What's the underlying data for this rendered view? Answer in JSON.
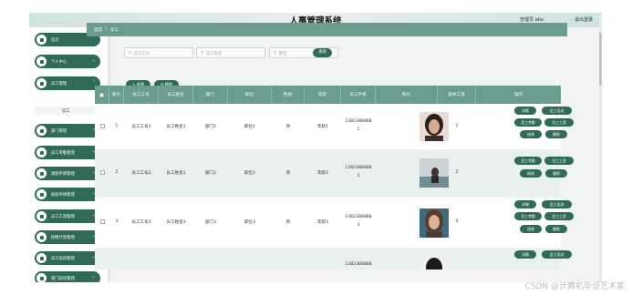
{
  "header": {
    "title": "人事管理系统",
    "user_label": "管理员 abo",
    "logout_label": "退出登录"
  },
  "sidebar": {
    "items": [
      {
        "label": "首页",
        "icon": "home-icon",
        "has_chevron": false
      },
      {
        "label": "个人中心",
        "icon": "user-icon",
        "has_chevron": true
      },
      {
        "label": "员工管理",
        "icon": "user-icon",
        "has_chevron": true
      },
      {
        "label": "部门管理",
        "icon": "shield-icon",
        "has_chevron": true
      },
      {
        "label": "员工考勤管理",
        "icon": "grid-icon",
        "has_chevron": true
      },
      {
        "label": "请假申请管理",
        "icon": "user-icon",
        "has_chevron": true
      },
      {
        "label": "加班申请管理",
        "icon": "user-icon",
        "has_chevron": true
      },
      {
        "label": "员工工资管理",
        "icon": "grid-icon",
        "has_chevron": true
      },
      {
        "label": "招聘计划管理",
        "icon": "grid-icon",
        "has_chevron": true
      },
      {
        "label": "员工培训管理",
        "icon": "grid-icon",
        "has_chevron": true
      },
      {
        "label": "部门培训管理",
        "icon": "user-icon",
        "has_chevron": true
      }
    ],
    "submenu_label": "员工"
  },
  "breadcrumb": {
    "home": "首页",
    "separator": "/",
    "current": "员工"
  },
  "search": {
    "field1_placeholder": "员工工号",
    "field2_placeholder": "员工姓名",
    "field3_placeholder": "职位",
    "button_label": "查询"
  },
  "toolbar": {
    "add_label": "+ 新增",
    "delete_label": "删除"
  },
  "table": {
    "columns": [
      "索引",
      "员工工号",
      "员工姓名",
      "部门",
      "职位",
      "性别",
      "年龄",
      "员工手机",
      "照片",
      "基本工资",
      "操作"
    ],
    "rows": [
      {
        "index": "1",
        "emp_no": "员工工号1",
        "name": "员工姓名1",
        "dept": "部门1",
        "position": "职位1",
        "gender": "男",
        "age": "年龄1",
        "phone_line1": "1382388888",
        "phone_line2": "1",
        "salary": "1"
      },
      {
        "index": "2",
        "emp_no": "员工工号2",
        "name": "员工姓名2",
        "dept": "部门2",
        "position": "职位2",
        "gender": "男",
        "age": "年龄2",
        "phone_line1": "1382388888",
        "phone_line2": "2",
        "salary": "2"
      },
      {
        "index": "3",
        "emp_no": "员工工号3",
        "name": "员工姓名3",
        "dept": "部门3",
        "position": "职位3",
        "gender": "男",
        "age": "年龄3",
        "phone_line1": "1382388888",
        "phone_line2": "3",
        "salary": "3"
      },
      {
        "index": "",
        "emp_no": "",
        "name": "",
        "dept": "",
        "position": "",
        "gender": "",
        "age": "",
        "phone_line1": "1382388888",
        "phone_line2": "",
        "salary": ""
      }
    ],
    "actions": {
      "detail": "详情",
      "training": "员工培训",
      "attendance": "员工考勤",
      "salary": "员工工资",
      "edit": "修改",
      "delete": "删除"
    }
  },
  "watermark": "CSDN @计算机毕设艺术家",
  "colors": {
    "primary": "#2f6b58",
    "header_row": "#6a9d8f",
    "stripe": "#e9f1ee"
  }
}
